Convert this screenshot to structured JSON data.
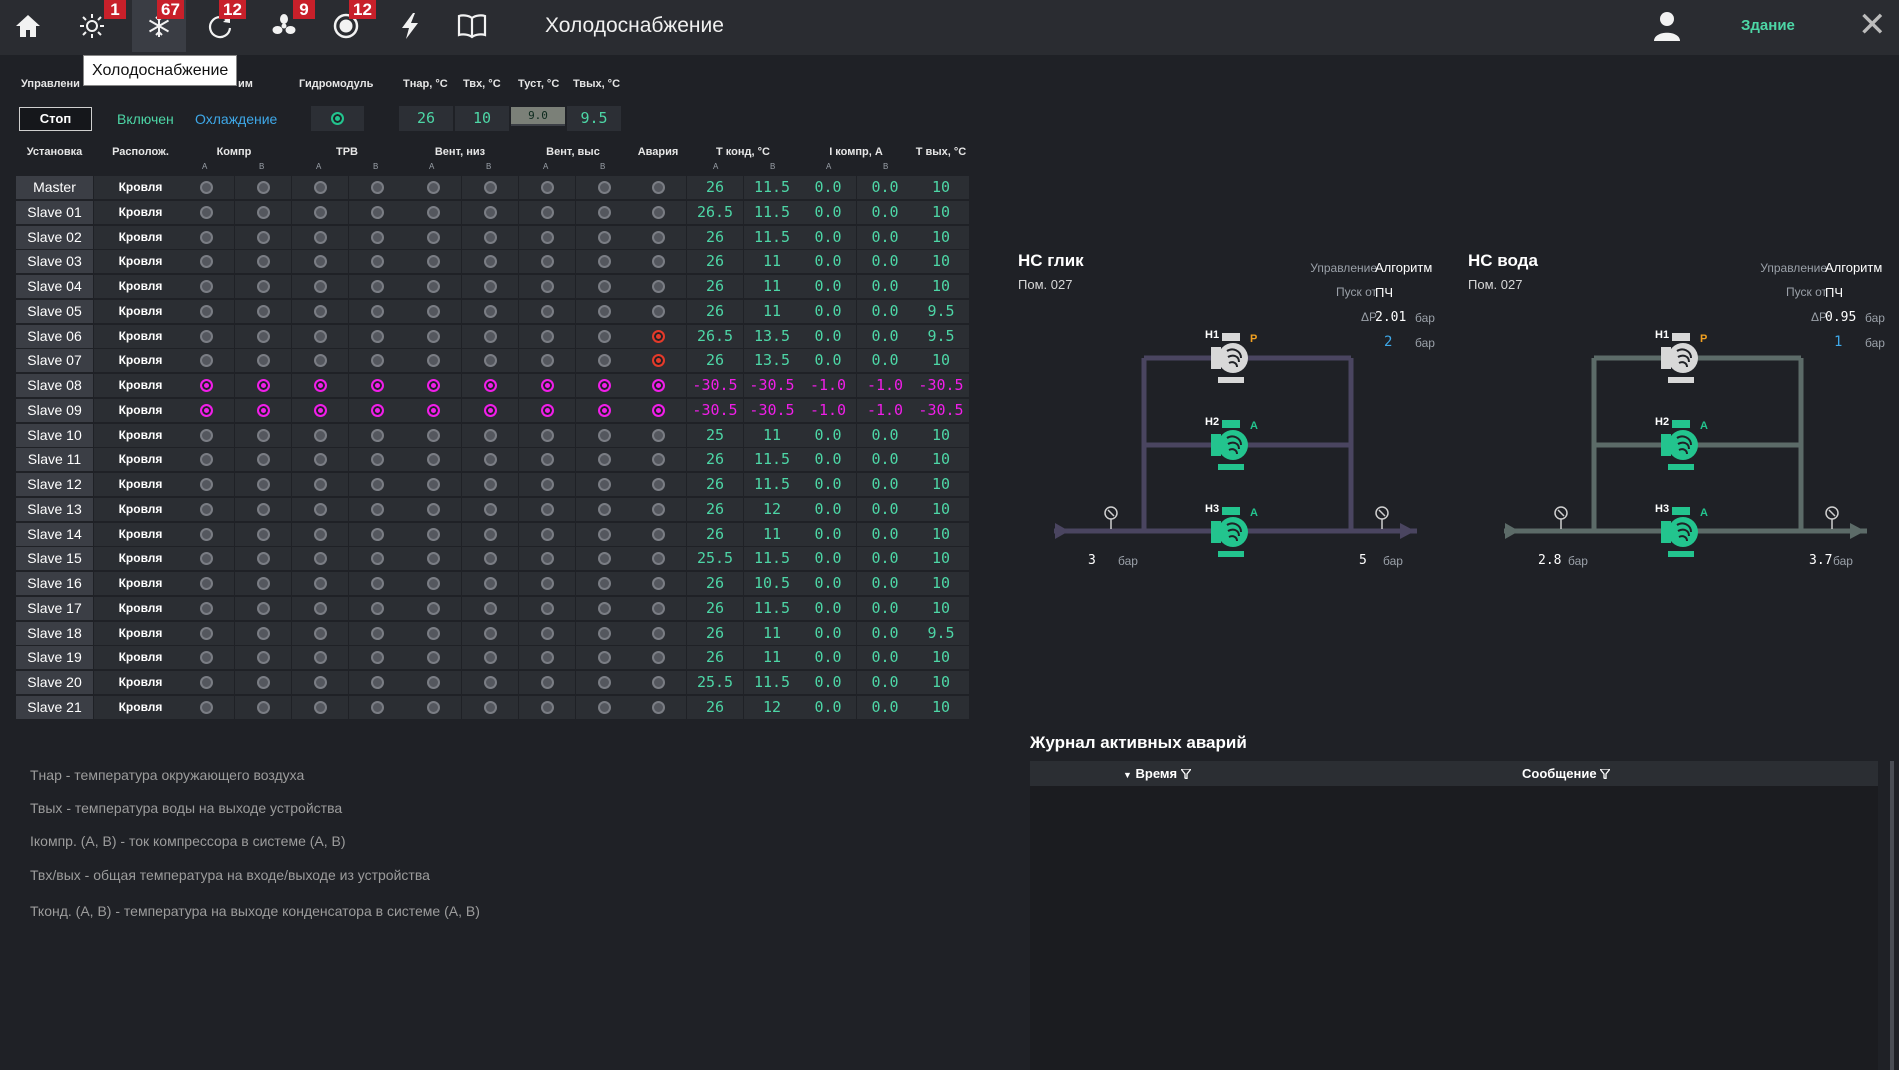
{
  "header": {
    "title": "Холодоснабжение",
    "building_link": "Здание",
    "tooltip": "Холодоснабжение",
    "nav": [
      {
        "icon": "home-icon",
        "badge": null
      },
      {
        "icon": "sun-icon",
        "badge": "1"
      },
      {
        "icon": "snowflake-icon",
        "badge": "67",
        "active": true
      },
      {
        "icon": "refresh-icon",
        "badge": "12"
      },
      {
        "icon": "fan-icon",
        "badge": "9"
      },
      {
        "icon": "record-icon",
        "badge": "12"
      },
      {
        "icon": "lightning-icon",
        "badge": null
      },
      {
        "icon": "book-icon",
        "badge": null
      }
    ]
  },
  "control": {
    "labels": {
      "control": "Управлени",
      "mode": "им",
      "hydromodule": "Гидромодуль",
      "t_out_air": "Тнар, °С",
      "t_in": "Твх, °С",
      "t_set": "Туст, °С",
      "t_out": "Твых, °С"
    },
    "stop_button": "Стоп",
    "status": "Включен",
    "mode": "Охлаждение",
    "t_out_air": "26",
    "t_in": "10",
    "t_set": "9.0",
    "t_out": "9.5"
  },
  "table": {
    "headers": {
      "unit": "Установка",
      "location": "Располож.",
      "comp": "Компр",
      "trv": "ТРВ",
      "fan_low": "Вент, низ",
      "fan_high": "Вент, выс",
      "alarm": "Авария",
      "t_cond": "Т конд, °С",
      "i_comp": "I компр, А",
      "t_out": "Т вых, °С"
    },
    "sub_a": "A",
    "sub_b": "B",
    "rows": [
      {
        "name": "Master",
        "loc": "Кровля",
        "state": "off",
        "alarm": "off",
        "tcA": "26",
        "tcB": "11.5",
        "iA": "0.0",
        "iB": "0.0",
        "tout": "10"
      },
      {
        "name": "Slave 01",
        "loc": "Кровля",
        "state": "off",
        "alarm": "off",
        "tcA": "26.5",
        "tcB": "11.5",
        "iA": "0.0",
        "iB": "0.0",
        "tout": "10"
      },
      {
        "name": "Slave 02",
        "loc": "Кровля",
        "state": "off",
        "alarm": "off",
        "tcA": "26",
        "tcB": "11.5",
        "iA": "0.0",
        "iB": "0.0",
        "tout": "10"
      },
      {
        "name": "Slave 03",
        "loc": "Кровля",
        "state": "off",
        "alarm": "off",
        "tcA": "26",
        "tcB": "11",
        "iA": "0.0",
        "iB": "0.0",
        "tout": "10"
      },
      {
        "name": "Slave 04",
        "loc": "Кровля",
        "state": "off",
        "alarm": "off",
        "tcA": "26",
        "tcB": "11",
        "iA": "0.0",
        "iB": "0.0",
        "tout": "10"
      },
      {
        "name": "Slave 05",
        "loc": "Кровля",
        "state": "off",
        "alarm": "off",
        "tcA": "26",
        "tcB": "11",
        "iA": "0.0",
        "iB": "0.0",
        "tout": "9.5"
      },
      {
        "name": "Slave 06",
        "loc": "Кровля",
        "state": "off",
        "alarm": "red",
        "tcA": "26.5",
        "tcB": "13.5",
        "iA": "0.0",
        "iB": "0.0",
        "tout": "9.5"
      },
      {
        "name": "Slave 07",
        "loc": "Кровля",
        "state": "off",
        "alarm": "red",
        "tcA": "26",
        "tcB": "13.5",
        "iA": "0.0",
        "iB": "0.0",
        "tout": "10"
      },
      {
        "name": "Slave 08",
        "loc": "Кровля",
        "state": "mag",
        "alarm": "mag",
        "tcA": "-30.5",
        "tcB": "-30.5",
        "iA": "-1.0",
        "iB": "-1.0",
        "tout": "-30.5"
      },
      {
        "name": "Slave 09",
        "loc": "Кровля",
        "state": "mag",
        "alarm": "mag",
        "tcA": "-30.5",
        "tcB": "-30.5",
        "iA": "-1.0",
        "iB": "-1.0",
        "tout": "-30.5"
      },
      {
        "name": "Slave 10",
        "loc": "Кровля",
        "state": "off",
        "alarm": "off",
        "tcA": "25",
        "tcB": "11",
        "iA": "0.0",
        "iB": "0.0",
        "tout": "10"
      },
      {
        "name": "Slave 11",
        "loc": "Кровля",
        "state": "off",
        "alarm": "off",
        "tcA": "26",
        "tcB": "11.5",
        "iA": "0.0",
        "iB": "0.0",
        "tout": "10"
      },
      {
        "name": "Slave 12",
        "loc": "Кровля",
        "state": "off",
        "alarm": "off",
        "tcA": "26",
        "tcB": "11.5",
        "iA": "0.0",
        "iB": "0.0",
        "tout": "10"
      },
      {
        "name": "Slave 13",
        "loc": "Кровля",
        "state": "off",
        "alarm": "off",
        "tcA": "26",
        "tcB": "12",
        "iA": "0.0",
        "iB": "0.0",
        "tout": "10"
      },
      {
        "name": "Slave 14",
        "loc": "Кровля",
        "state": "off",
        "alarm": "off",
        "tcA": "26",
        "tcB": "11",
        "iA": "0.0",
        "iB": "0.0",
        "tout": "10"
      },
      {
        "name": "Slave 15",
        "loc": "Кровля",
        "state": "off",
        "alarm": "off",
        "tcA": "25.5",
        "tcB": "11.5",
        "iA": "0.0",
        "iB": "0.0",
        "tout": "10"
      },
      {
        "name": "Slave 16",
        "loc": "Кровля",
        "state": "off",
        "alarm": "off",
        "tcA": "26",
        "tcB": "10.5",
        "iA": "0.0",
        "iB": "0.0",
        "tout": "10"
      },
      {
        "name": "Slave 17",
        "loc": "Кровля",
        "state": "off",
        "alarm": "off",
        "tcA": "26",
        "tcB": "11.5",
        "iA": "0.0",
        "iB": "0.0",
        "tout": "10"
      },
      {
        "name": "Slave 18",
        "loc": "Кровля",
        "state": "off",
        "alarm": "off",
        "tcA": "26",
        "tcB": "11",
        "iA": "0.0",
        "iB": "0.0",
        "tout": "9.5"
      },
      {
        "name": "Slave 19",
        "loc": "Кровля",
        "state": "off",
        "alarm": "off",
        "tcA": "26",
        "tcB": "11",
        "iA": "0.0",
        "iB": "0.0",
        "tout": "10"
      },
      {
        "name": "Slave 20",
        "loc": "Кровля",
        "state": "off",
        "alarm": "off",
        "tcA": "25.5",
        "tcB": "11.5",
        "iA": "0.0",
        "iB": "0.0",
        "tout": "10"
      },
      {
        "name": "Slave 21",
        "loc": "Кровля",
        "state": "off",
        "alarm": "off",
        "tcA": "26",
        "tcB": "12",
        "iA": "0.0",
        "iB": "0.0",
        "tout": "10"
      }
    ]
  },
  "notes": [
    "Тнар - температура окружающего воздуха",
    "Твых - температура воды на выходе устройства",
    "Iкомпр. (А, В) - ток компрессора в системе (А, В)",
    "Твх/вых - общая температура на входе/выходе из устройства",
    "Тконд. (А, В) - температура на выходе конденсатора в системе (А, В)"
  ],
  "stations": [
    {
      "title": "НС глик",
      "room": "Пом. 027",
      "control_label": "Управление",
      "control_value": "Алгоритм",
      "start_label": "Пуск от",
      "start_value": "ПЧ",
      "dp_label": "ΔР",
      "dp_value": "2.01",
      "dp_unit": "бар",
      "count_value": "2",
      "count_unit": "бар",
      "in_pressure": "3",
      "out_pressure": "5",
      "pressure_unit": "бар",
      "pipe_color": "#4a4560",
      "pumps": [
        {
          "label": "Н1",
          "mode": "Р",
          "state": "reserve"
        },
        {
          "label": "Н2",
          "mode": "А",
          "state": "on"
        },
        {
          "label": "Н3",
          "mode": "А",
          "state": "on"
        }
      ]
    },
    {
      "title": "НС вода",
      "room": "Пом. 027",
      "control_label": "Управление",
      "control_value": "Алгоритм",
      "start_label": "Пуск от",
      "start_value": "ПЧ",
      "dp_label": "ΔР",
      "dp_value": "0.95",
      "dp_unit": "бар",
      "count_value": "1",
      "count_unit": "бар",
      "in_pressure": "2.8",
      "out_pressure": "3.7",
      "pressure_unit": "бар",
      "pipe_color": "#5c6b68",
      "pumps": [
        {
          "label": "Н1",
          "mode": "Р",
          "state": "reserve"
        },
        {
          "label": "Н2",
          "mode": "А",
          "state": "on"
        },
        {
          "label": "Н3",
          "mode": "А",
          "state": "on"
        }
      ]
    }
  ],
  "journal": {
    "title": "Журнал активных аварий",
    "col_time": "Время",
    "col_message": "Сообщение"
  },
  "colors": {
    "accent_green": "#23c48e",
    "value_green": "#4dd6a6",
    "alarm_red": "#e43a2a",
    "fault_magenta": "#f01ee8",
    "badge_red": "#c8202a",
    "mode_blue": "#3ea8e8",
    "reserve_pump": "#d8d8d8",
    "reserve_mark": "#f0a020"
  }
}
